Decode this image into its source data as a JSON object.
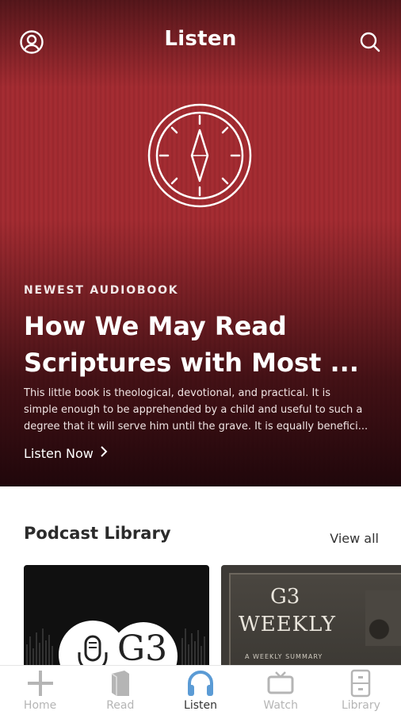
{
  "header": {
    "title": "Listen",
    "profile_icon": "profile-icon",
    "search_icon": "search-icon"
  },
  "hero": {
    "eyebrow": "NEWEST AUDIOBOOK",
    "title_lines": [
      "How We May Read",
      "Scriptures with Most ..."
    ],
    "description_lines": [
      "This little book is theological, devotional, and practical. It is",
      "simple enough to be apprehended by a child and useful to such a",
      "degree that it will serve him until the grave. It is equally benefici..."
    ],
    "cta_label": "Listen Now",
    "cover_icon": "compass-icon",
    "colors": {
      "background": "#a32a30",
      "text": "#ffffff"
    }
  },
  "podcast_library": {
    "title": "Podcast Library",
    "view_all_label": "View all",
    "cards": [
      {
        "logo": "G3",
        "icon": "microphone-icon"
      },
      {
        "title_line1": "G3",
        "title_line2": "WEEKLY",
        "subtitle": "A WEEKLY SUMMARY"
      }
    ]
  },
  "bottom_nav": {
    "items": [
      {
        "label": "Home",
        "icon": "plus-icon",
        "active": false
      },
      {
        "label": "Read",
        "icon": "book-icon",
        "active": false
      },
      {
        "label": "Listen",
        "icon": "headphones-icon",
        "active": true
      },
      {
        "label": "Watch",
        "icon": "tv-icon",
        "active": false
      },
      {
        "label": "Library",
        "icon": "filing-cabinet-icon",
        "active": false
      }
    ],
    "colors": {
      "active_icon": "#5b9bd5",
      "inactive": "#b5b5b5",
      "active_label": "#333333"
    }
  }
}
